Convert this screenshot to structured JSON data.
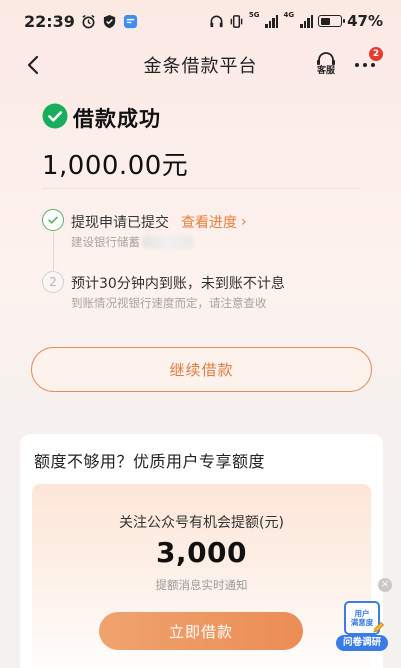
{
  "status_bar": {
    "time": "22:39",
    "network_tag_1": "5G",
    "network_tag_2": "4G",
    "battery_percent": "47%",
    "battery_level": 0.47
  },
  "nav": {
    "title": "金条借款平台",
    "service_label": "客服",
    "badge_count": "2"
  },
  "result": {
    "title": "借款成功",
    "amount": "1,000.00元"
  },
  "steps": [
    {
      "title": "提现申请已提交",
      "link": "查看进度",
      "link_arrow": "›",
      "subtitle": "建设银行储蓄",
      "index": "1",
      "done": true
    },
    {
      "title": "预计30分钟内到账，未到账不计息",
      "subtitle": "到账情况视银行速度而定，请注意查收",
      "index": "2",
      "done": false
    }
  ],
  "continue_button": "继续借款",
  "promo": {
    "title": "额度不够用？优质用户专享额度",
    "label": "关注公众号有机会提额(元)",
    "value": "3,000",
    "note": "提额消息实时通知",
    "button": "立即借款"
  },
  "survey": {
    "card_line1": "用户",
    "card_line2": "满意度",
    "label": "问卷调研",
    "close": "×"
  },
  "colors": {
    "accent": "#e97d3b",
    "success": "#1aad5b",
    "survey_blue": "#3a7be6"
  }
}
